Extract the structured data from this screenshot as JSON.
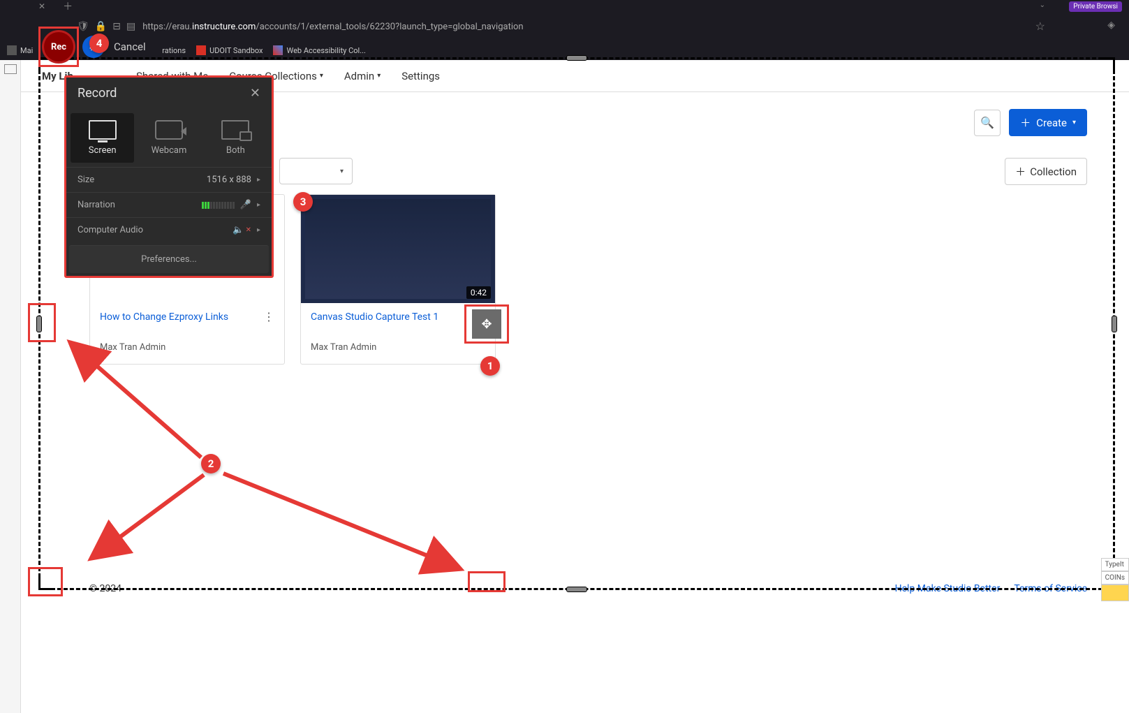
{
  "browser": {
    "private_label": "Private Browsi",
    "url_prefix": "https://erau.",
    "url_domain": "instructure.com",
    "url_path": "/accounts/1/external_tools/62230?launch_type=global_navigation",
    "bookmarks": [
      "Mai",
      "rations",
      "UDOIT Sandbox",
      "Web Accessibility Col..."
    ]
  },
  "recorder": {
    "rec_label": "Rec",
    "cancel_label": "Cancel",
    "dialog_title": "Record",
    "modes": {
      "screen": "Screen",
      "webcam": "Webcam",
      "both": "Both"
    },
    "size_label": "Size",
    "size_value": "1516 x 888",
    "narration_label": "Narration",
    "audio_label": "Computer Audio",
    "preferences": "Preferences..."
  },
  "nav": {
    "my_library": "My Lib",
    "shared": "Shared with Me",
    "course": "Course Collections",
    "admin": "Admin",
    "settings": "Settings"
  },
  "toolbar": {
    "create": "Create",
    "collection": "Collection"
  },
  "cards": [
    {
      "title": "How to Change Ezproxy Links",
      "author": "Max Tran Admin"
    },
    {
      "title": "Canvas Studio Capture Test 1",
      "author": "Max Tran Admin",
      "duration": "0:42"
    }
  ],
  "footer": {
    "copyright": "© 2024",
    "help": "Help Make Studio Better",
    "terms": "Terms of Service"
  },
  "annotations": {
    "b1": "1",
    "b2": "2",
    "b3": "3",
    "b4": "4"
  },
  "side": {
    "typeit": "TypeIt",
    "coins": "COINs"
  }
}
